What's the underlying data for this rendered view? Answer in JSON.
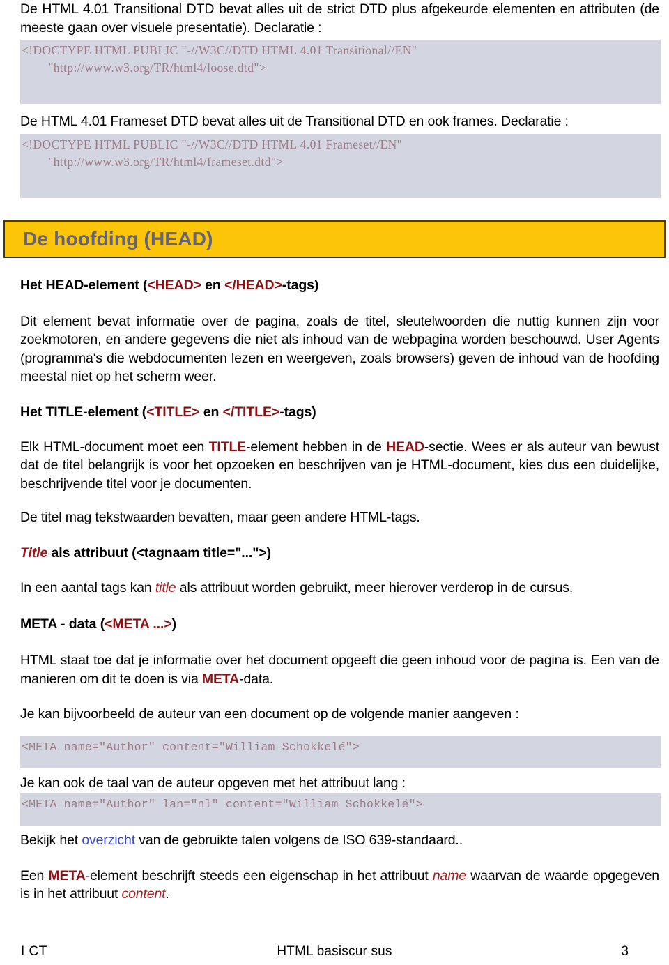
{
  "document": {
    "intro": {
      "transitional_text_1": "De HTML 4.01 Transitional DTD bevat alles uit de strict DTD plus afgekeurde elementen en attributen (de meeste gaan over visuele presentatie). Declaratie :",
      "transitional_code": "<!DOCTYPE HTML PUBLIC \"-//W3C//DTD HTML 4.01 Transitional//EN\"\n        \"http://www.w3.org/TR/html4/loose.dtd\">",
      "frameset_text": "De HTML 4.01 Frameset DTD bevat alles uit de Transitional DTD en ook frames. Declaratie :",
      "frameset_code": "<!DOCTYPE HTML PUBLIC \"-//W3C//DTD HTML 4.01 Frameset//EN\"\n        \"http://www.w3.org/TR/html4/frameset.dtd\">"
    },
    "banner": {
      "title": "De hoofding (HEAD)"
    },
    "head_element": {
      "heading_part1": "Het HEAD-element (",
      "heading_tag_open": "<HEAD>",
      "heading_mid": " en ",
      "heading_tag_close": "</HEAD>",
      "heading_part2": "-tags)",
      "body": "Dit element bevat informatie over de pagina, zoals de titel, sleutelwoorden die nuttig kunnen zijn voor zoekmotoren, en andere gegevens die niet als inhoud van de webpagina worden beschouwd. User Agents (programma's die webdocumenten lezen en weergeven, zoals browsers) geven de inhoud van de hoofding meestal niet op het scherm weer."
    },
    "title_element": {
      "heading_part1": "Het TITLE-element (",
      "heading_tag_open": "<TITLE>",
      "heading_mid": " en ",
      "heading_tag_close": "</TITLE>",
      "heading_part2": "-tags)",
      "body_a": "Elk HTML-document moet een ",
      "body_kw1": "TITLE",
      "body_b": "-element hebben in de ",
      "body_kw2": "HEAD",
      "body_c": "-sectie. Wees er als auteur van bewust dat de titel belangrijk is voor het opzoeken en beschrijven van je HTML-document, kies dus een duidelijke, beschrijvende titel voor je documenten.",
      "body_2": "De titel mag tekstwaarden bevatten, maar geen andere HTML-tags."
    },
    "title_attribute": {
      "heading_kw": "Title",
      "heading_rest": " als attribuut (<tagnaam title=\"...\">)",
      "body_a": "In een aantal tags kan ",
      "body_kw": "title",
      "body_b": " als attribuut worden gebruikt, meer hierover verderop in de cursus."
    },
    "meta_data": {
      "heading_part1": "META - data (",
      "heading_tag": "<META ...>",
      "heading_part2": ")",
      "body_a": "HTML staat toe dat je informatie over het document opgeeft die geen inhoud voor de pagina is. Een van de manieren om dit te doen is via ",
      "body_kw": "META",
      "body_b": "-data.",
      "example_lead": "Je kan bijvoorbeeld de auteur van een document op de volgende manier aangeven :",
      "example_code_1": "<META name=\"Author\" content=\"William Schokkelé\">",
      "lang_lead": "Je kan ook de taal van de auteur opgeven met het attribuut lang :",
      "example_code_2": "<META name=\"Author\" lan=\"nl\" content=\"William Schokkelé\">",
      "iso_a": "Bekijk het ",
      "iso_link": "overzicht",
      "iso_b": " van de gebruikte talen volgens de ISO 639-standaard..",
      "desc_a": "Een ",
      "desc_kw1": "META",
      "desc_b": "-element beschrijft steeds een eigenschap in het attribuut ",
      "desc_kw2": "name",
      "desc_c": " waarvan de waarde opgegeven is in het attribuut ",
      "desc_kw3": "content",
      "desc_d": "."
    },
    "footer": {
      "left": "I CT",
      "center": "HTML basiscur sus",
      "page_number": "3"
    },
    "colors": {
      "banner_background": "#fdc507",
      "banner_border": "#4a3b04",
      "banner_text": "#63637a",
      "code_background": "#d3d5e0",
      "code_text": "#9c7b84",
      "keyword_red": "#8b1014",
      "link_blue": "#3a46d6"
    }
  }
}
